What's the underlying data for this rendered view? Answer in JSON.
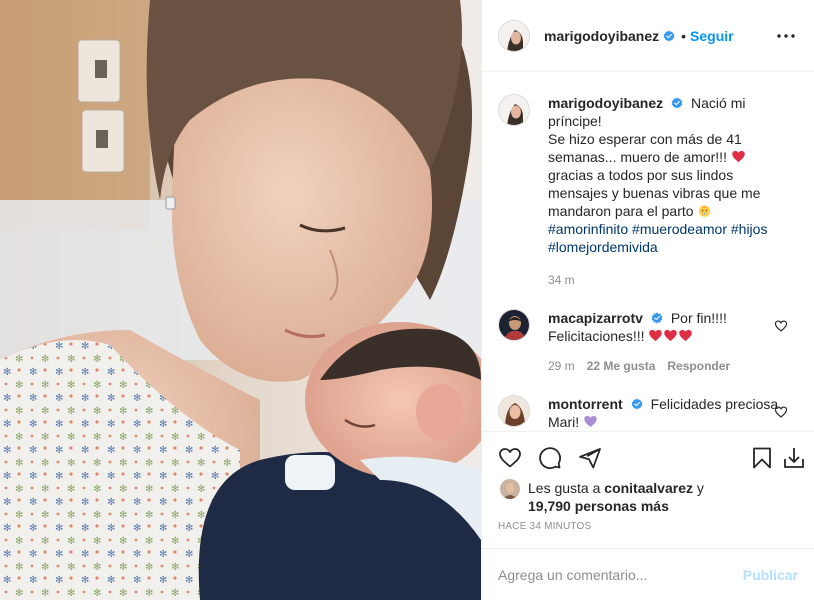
{
  "post": {
    "author": "marigodoyibanez",
    "follow_label": "Seguir",
    "separator": "•",
    "caption_lines": [
      "Nació mi príncipe!",
      "Se hizo esperar con más de 41",
      "semanas... muero de amor!!!",
      "gracias a todos por sus lindos",
      "mensajes y buenas vibras que me",
      "mandaron para el parto"
    ],
    "hashtags": [
      "#amorinfinito",
      "#muerodeamor",
      "#hijos",
      "#lomejordemivida"
    ],
    "caption_time": "34 m"
  },
  "comments": [
    {
      "user": "macapizarrotv",
      "text_1": "Por fin!!!!",
      "text_2": "Felicitaciones!!!",
      "time": "29 m",
      "likes": "22 Me gusta",
      "reply": "Responder"
    },
    {
      "user": "montorrent",
      "text_1": "Felicidades preciosa",
      "text_2": "Mari!"
    }
  ],
  "likes": {
    "prefix": "Les gusta a",
    "user": "conitaalvarez",
    "joiner": "y",
    "others": "19,790 personas más"
  },
  "time_ago": "HACE 34 MINUTOS",
  "add_comment": {
    "placeholder": "Agrega un comentario...",
    "publish_label": "Publicar"
  },
  "colors": {
    "accent": "#0095f6",
    "verified": "#3897f0",
    "hashtag": "#00376b",
    "muted": "#8e8e8e",
    "heart": "#e0245e",
    "publish_disabled": "#b2dffc"
  },
  "icons": [
    "verified-badge-icon",
    "more-options-icon",
    "heart-icon",
    "comment-icon",
    "share-icon",
    "bookmark-icon",
    "download-icon",
    "red-heart-emoji",
    "baby-emoji",
    "purple-heart-emoji"
  ]
}
